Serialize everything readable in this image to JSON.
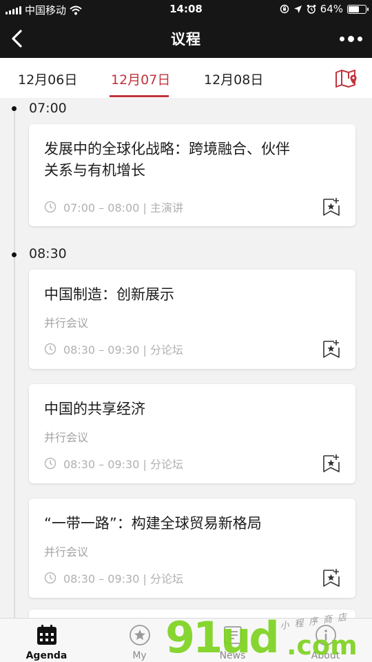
{
  "status_bar": {
    "carrier": "中国移动",
    "time": "14:08",
    "battery": "64%",
    "battery_level": 0.64
  },
  "nav": {
    "title": "议程"
  },
  "date_tabs": [
    {
      "label": "12月06日",
      "active": false
    },
    {
      "label": "12月07日",
      "active": true
    },
    {
      "label": "12月08日",
      "active": false
    }
  ],
  "accent_color": "#c0333c",
  "schedule": [
    {
      "time": "07:00",
      "sessions": [
        {
          "title": "发展中的全球化战略：跨境融合、伙伴关系与有机增长",
          "subtitle": "",
          "meta": "07:00 – 08:00 | 主演讲"
        }
      ]
    },
    {
      "time": "08:30",
      "sessions": [
        {
          "title": "中国制造：创新展示",
          "subtitle": "并行会议",
          "meta": "08:30 – 09:30 | 分论坛"
        },
        {
          "title": "中国的共享经济",
          "subtitle": "并行会议",
          "meta": "08:30 – 09:30 | 分论坛"
        },
        {
          "title": "“一带一路”：构建全球贸易新格局",
          "subtitle": "并行会议",
          "meta": "08:30 – 09:30 | 分论坛"
        }
      ]
    }
  ],
  "tab_bar": [
    {
      "label": "Agenda",
      "icon": "calendar-icon",
      "active": true
    },
    {
      "label": "My",
      "icon": "star-icon",
      "active": false
    },
    {
      "label": "News",
      "icon": "news-icon",
      "active": false
    },
    {
      "label": "About",
      "icon": "info-icon",
      "active": false
    }
  ],
  "watermark": {
    "brand": "91ud",
    "suffix": ".com",
    "tagline": "小程序商店"
  }
}
